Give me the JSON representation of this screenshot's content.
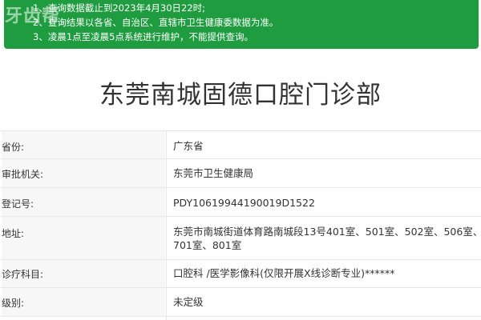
{
  "notice": {
    "watermark": "牙齿帮",
    "lines": [
      "1、查询数据截止到2023年4月30日22时;",
      "2、查询结果以各省、自治区、直辖市卫生健康委数据为准。",
      "3、凌晨1点至凌晨5点系统进行维护，不能提供查询。"
    ]
  },
  "title": "东莞南城固德口腔门诊部",
  "rows": [
    {
      "label": "省份:",
      "value": "广东省"
    },
    {
      "label": "审批机关:",
      "value": "东莞市卫生健康局"
    },
    {
      "label": "登记号:",
      "value": "PDY10619944190019D1522"
    },
    {
      "label": "地址:",
      "value": "东莞市南城街道体育路南城段13号401室、501室、502室、506室、601",
      "value2": "701室、801室"
    },
    {
      "label": "诊疗科目:",
      "value": "口腔科 /医学影像科(仅限开展X线诊断专业)******"
    },
    {
      "label": "级别:",
      "value": "未定级"
    }
  ],
  "colors": {
    "notice_bg": "#1e9c3f",
    "label_bg": "#f7f7f7",
    "border": "#e8e8e8"
  }
}
